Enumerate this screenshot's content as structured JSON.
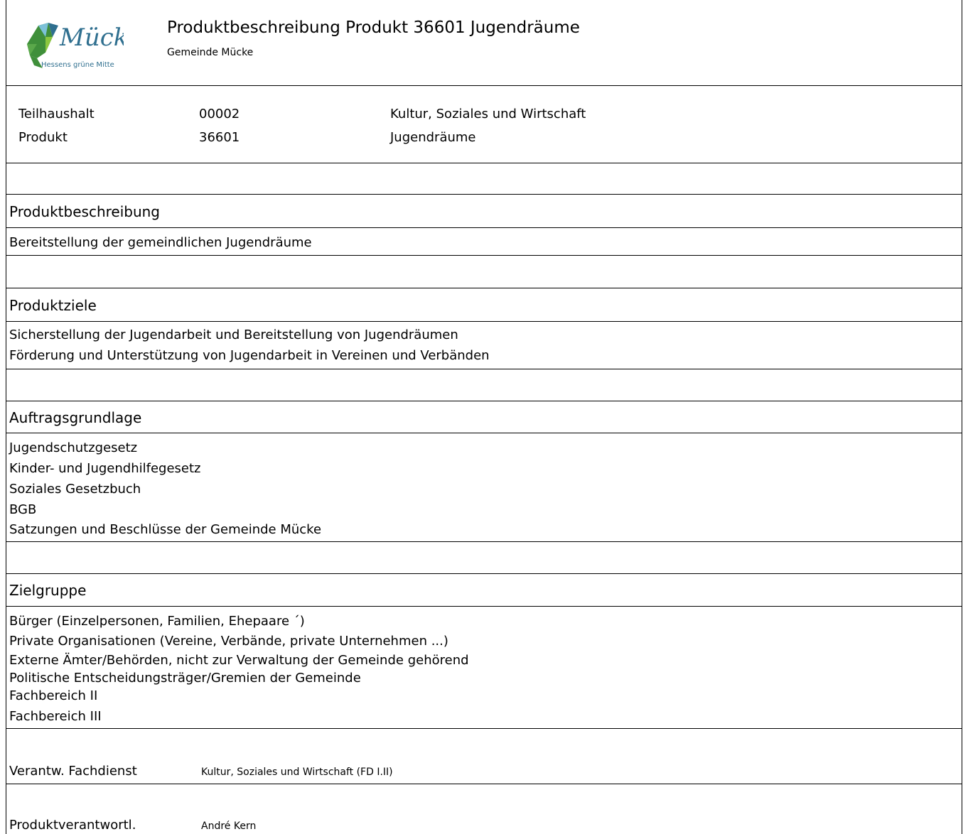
{
  "header": {
    "title": "Produktbeschreibung Produkt 36601 Jugendräume",
    "subtitle": "Gemeinde Mücke",
    "logo": {
      "wordmark": "Mücke",
      "tagline": "Hessens grüne Mitte"
    }
  },
  "meta": [
    {
      "label": "Teilhaushalt",
      "code": "00002",
      "name": "Kultur, Soziales und Wirtschaft"
    },
    {
      "label": "Produkt",
      "code": "36601",
      "name": "Jugendräume"
    }
  ],
  "sections": {
    "beschreibung": {
      "heading": "Produktbeschreibung",
      "lines": [
        "Bereitstellung der gemeindlichen Jugendräume"
      ]
    },
    "ziele": {
      "heading": "Produktziele",
      "lines": [
        "Sicherstellung der Jugendarbeit und Bereitstellung von Jugendräumen",
        "Förderung und Unterstützung von Jugendarbeit in Vereinen und Verbänden"
      ]
    },
    "auftrag": {
      "heading": "Auftragsgrundlage",
      "lines": [
        "Jugendschutzgesetz",
        "Kinder- und Jugendhilfegesetz",
        "Soziales Gesetzbuch",
        "BGB",
        "Satzungen und Beschlüsse der Gemeinde Mücke"
      ]
    },
    "zielgruppe": {
      "heading": "Zielgruppe",
      "lines": [
        "Bürger (Einzelpersonen, Familien, Ehepaare ´)",
        "Private Organisationen (Vereine, Verbände, private Unternehmen ...)",
        "Externe Ämter/Behörden, nicht zur Verwaltung der Gemeinde gehörend",
        "Politische Entscheidungsträger/Gremien der Gemeinde",
        "Fachbereich II",
        "Fachbereich III"
      ]
    }
  },
  "footer": {
    "fachdienst_label": "Verantw. Fachdienst",
    "fachdienst_value": "Kultur, Soziales und Wirtschaft (FD I.II)",
    "verantwortlich_label": "Produktverantwortl.",
    "verantwortlich_value": "André Kern"
  }
}
